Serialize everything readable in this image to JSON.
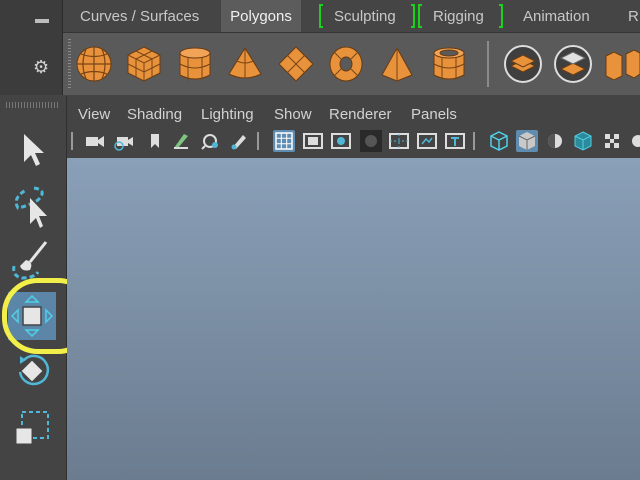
{
  "tabs": [
    {
      "label": "Curves / Surfaces"
    },
    {
      "label": "Polygons",
      "active": true
    },
    {
      "label": "Sculpting"
    },
    {
      "label": "Rigging"
    },
    {
      "label": "Animation"
    },
    {
      "label": "R"
    }
  ],
  "shelf": {
    "icons": [
      "sphere-icon",
      "cube-icon",
      "cylinder-icon",
      "cone-icon",
      "plane-icon",
      "torus-icon",
      "pyramid-icon",
      "pipe-icon",
      "combine-icon",
      "separate-icon",
      "extract-icon"
    ]
  },
  "panel_menu": [
    "View",
    "Shading",
    "Lighting",
    "Show",
    "Renderer",
    "Panels"
  ],
  "tools": [
    "select-tool-icon",
    "lasso-tool-icon",
    "paint-select-tool-icon",
    "move-tool-icon",
    "rotate-tool-icon",
    "scale-tool-icon"
  ],
  "active_tool": "move-tool-icon",
  "colors": {
    "accent_blue": "#5c86a8",
    "shelf_orange": "#e8923c",
    "highlight": "#f2ef4a",
    "tab_separator": "#1ed01e"
  }
}
